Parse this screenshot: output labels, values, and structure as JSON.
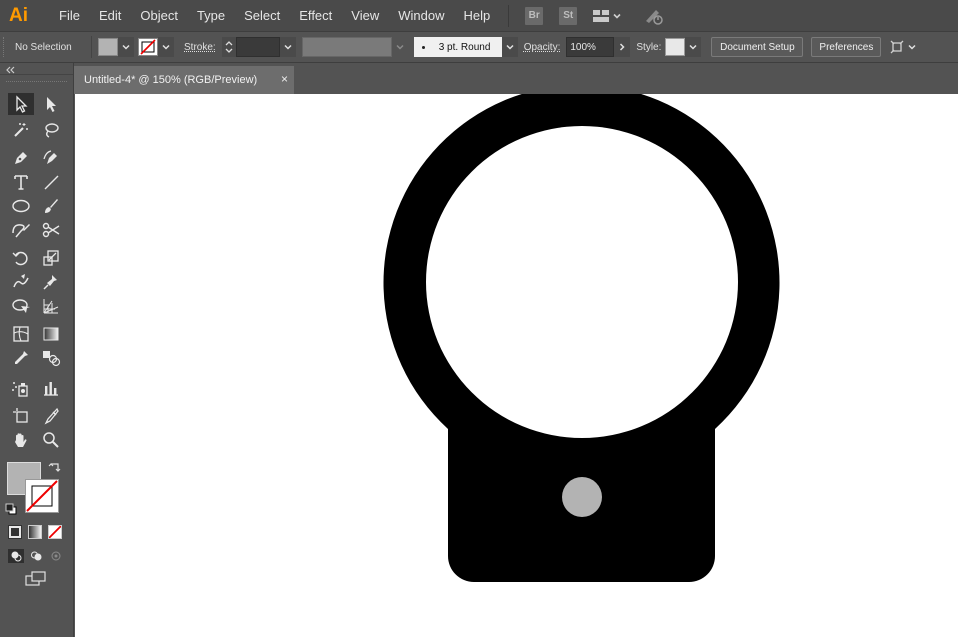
{
  "app": {
    "logo_text": "Ai",
    "menus": [
      "File",
      "Edit",
      "Object",
      "Type",
      "Select",
      "Effect",
      "View",
      "Window",
      "Help"
    ],
    "bridge_label": "Br",
    "stock_label": "St"
  },
  "control_bar": {
    "selection_status": "No Selection",
    "stroke_label": "Stroke:",
    "brush_label": "3 pt. Round",
    "opacity_label": "Opacity:",
    "opacity_value": "100%",
    "style_label": "Style:",
    "document_setup_label": "Document Setup",
    "preferences_label": "Preferences",
    "fill_color": "#b3b3b3"
  },
  "document": {
    "tab_title": "Untitled-4* @ 150% (RGB/Preview)",
    "close_glyph": "×"
  },
  "artwork": {
    "shape_color": "#000000",
    "dot_color": "#b3b3b3",
    "background_color": "#ffffff"
  },
  "icons": {
    "selection": "selection-arrow-icon",
    "direct_selection": "direct-selection-icon",
    "magic_wand": "magic-wand-icon",
    "lasso": "lasso-icon",
    "pen": "pen-icon",
    "curvature": "curvature-icon",
    "type": "type-icon",
    "line": "line-segment-icon",
    "ellipse": "ellipse-icon",
    "paintbrush": "paintbrush-icon",
    "shaper": "shaper-icon",
    "scissors": "scissors-icon",
    "rotate": "rotate-icon",
    "scale": "scale-icon",
    "warp": "warp-icon",
    "puppet": "puppet-warp-icon",
    "shape_builder": "shape-builder-icon",
    "perspective": "perspective-grid-icon",
    "mesh": "mesh-icon",
    "gradient": "gradient-icon",
    "eyedropper": "eyedropper-icon",
    "blend": "blend-icon",
    "symbol_sprayer": "symbol-sprayer-icon",
    "graph": "column-graph-icon",
    "artboard": "artboard-icon",
    "slice": "slice-icon",
    "hand": "hand-icon",
    "zoom": "zoom-icon"
  }
}
